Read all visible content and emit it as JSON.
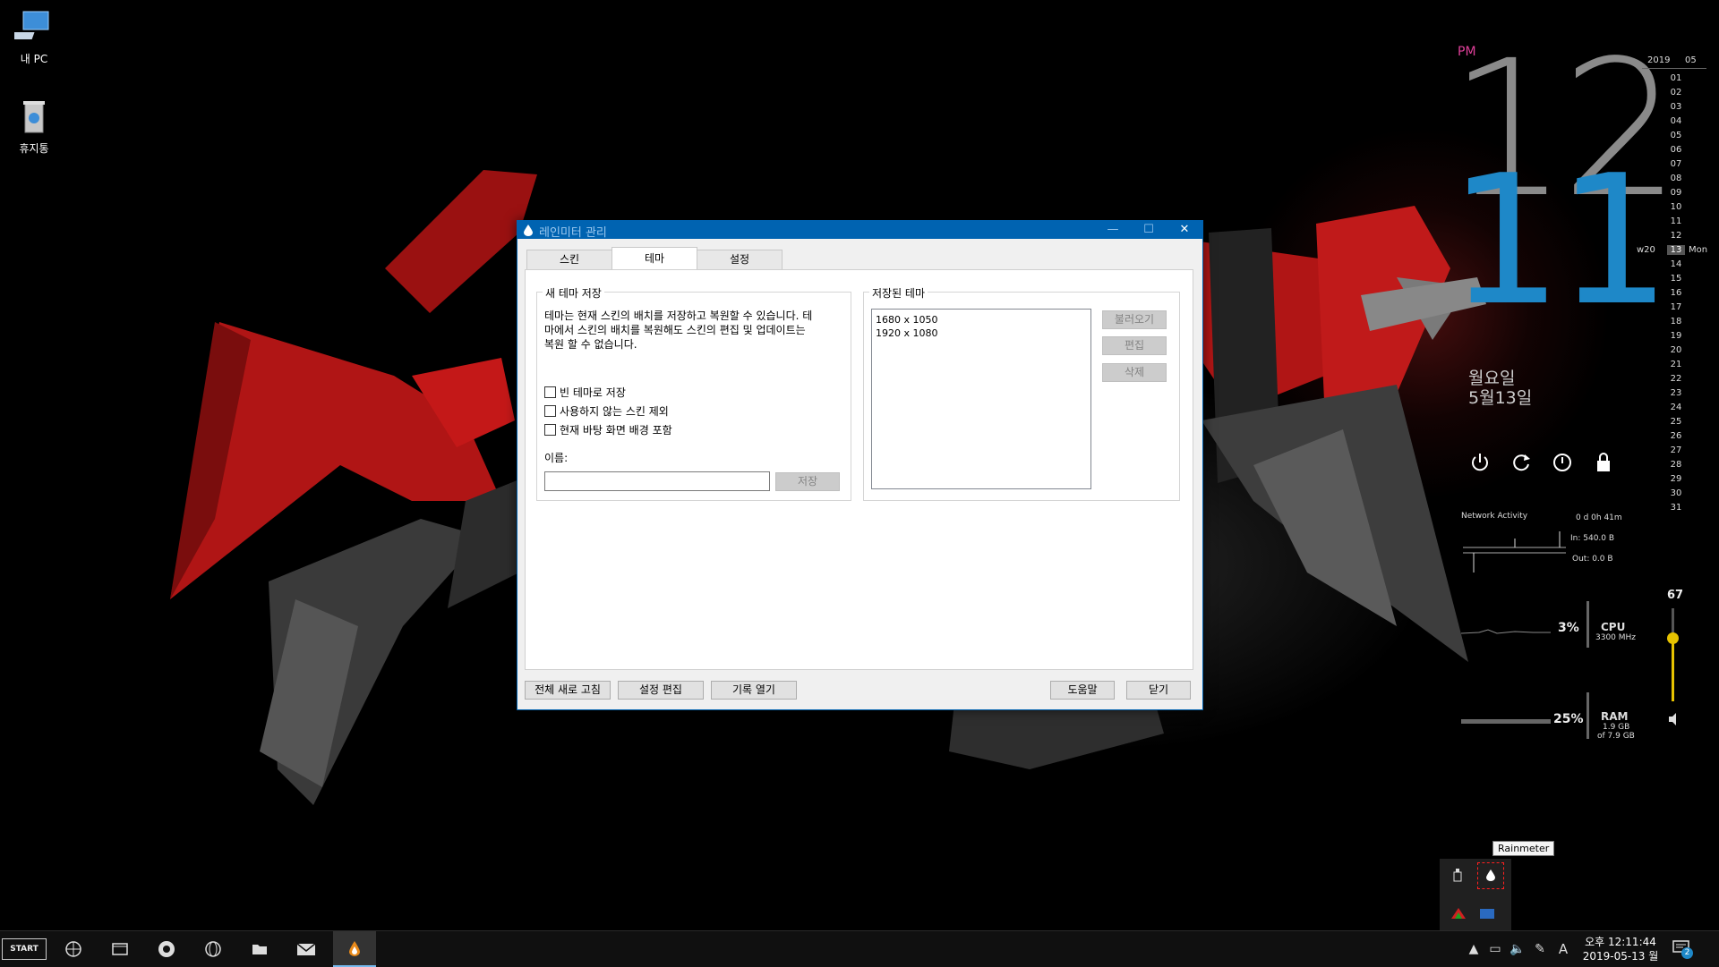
{
  "desktop": {
    "icons": [
      {
        "label": "내 PC"
      },
      {
        "label": "휴지통"
      }
    ]
  },
  "dialog": {
    "title": "레인미터 관리",
    "window_controls": {
      "minimize": "—",
      "maximize": "☐",
      "close": "✕"
    },
    "tabs": [
      {
        "label": "스킨",
        "active": false
      },
      {
        "label": "테마",
        "active": true
      },
      {
        "label": "설정",
        "active": false
      }
    ],
    "new_theme": {
      "legend": "새 테마 저장",
      "description_lines": [
        "테마는 현재 스킨의 배치를 저장하고 복원할 수 있습니다. 테",
        "마에서 스킨의 배치를 복원해도 스킨의 편집 및 업데이트는",
        "복원 할 수 없습니다."
      ],
      "checkboxes": [
        {
          "label": "빈 테마로 저장",
          "checked": false
        },
        {
          "label": "사용하지 않는 스킨 제외",
          "checked": false
        },
        {
          "label": "현재 바탕 화면 배경 포함",
          "checked": false
        }
      ],
      "name_label": "이름:",
      "name_value": "",
      "save_button": "저장"
    },
    "saved_themes": {
      "legend": "저장된 테마",
      "items": [
        "1680 x 1050",
        "1920 x 1080"
      ],
      "load_button": "불러오기",
      "edit_button": "편집",
      "delete_button": "삭제"
    },
    "footer": {
      "refresh_all": "전체 새로 고침",
      "edit_settings": "설정 편집",
      "open_log": "기록 열기",
      "help": "도움말",
      "close": "닫기"
    }
  },
  "clock": {
    "ampm": "PM",
    "hour": "12",
    "minute": "11",
    "weekday": "월요일",
    "date": "5월13일"
  },
  "calendar": {
    "year": "2019",
    "month": "05",
    "week_label": "w20",
    "day_label": "Mon",
    "today": "13",
    "days": [
      "01",
      "02",
      "03",
      "04",
      "05",
      "06",
      "07",
      "08",
      "09",
      "10",
      "11",
      "12",
      "13",
      "14",
      "15",
      "16",
      "17",
      "18",
      "19",
      "20",
      "21",
      "22",
      "23",
      "24",
      "25",
      "26",
      "27",
      "28",
      "29",
      "30",
      "31"
    ]
  },
  "network": {
    "title": "Network Activity",
    "uptime": "0 d 0h 41m",
    "in": "In: 540.0 B",
    "out": "Out: 0.0 B"
  },
  "cpu": {
    "percent": "3%",
    "label": "CPU",
    "sub": "3300 MHz"
  },
  "ram": {
    "percent": "25%",
    "label": "RAM",
    "sub1": "1.9 GB",
    "sub2": "of 7.9 GB"
  },
  "volume": {
    "value": "67",
    "level_fraction": 0.67
  },
  "tray_popup": {
    "tooltip": "Rainmeter"
  },
  "taskbar": {
    "start_label": "START",
    "ime_label": "A",
    "time": "오후 12:11:44",
    "date": "2019-05-13 월",
    "notification_count": "2"
  },
  "colors": {
    "accent": "#0063b1",
    "clock_hour": "#8a8a8a",
    "clock_minute": "#1e88c8",
    "ampm": "#e0409a"
  }
}
